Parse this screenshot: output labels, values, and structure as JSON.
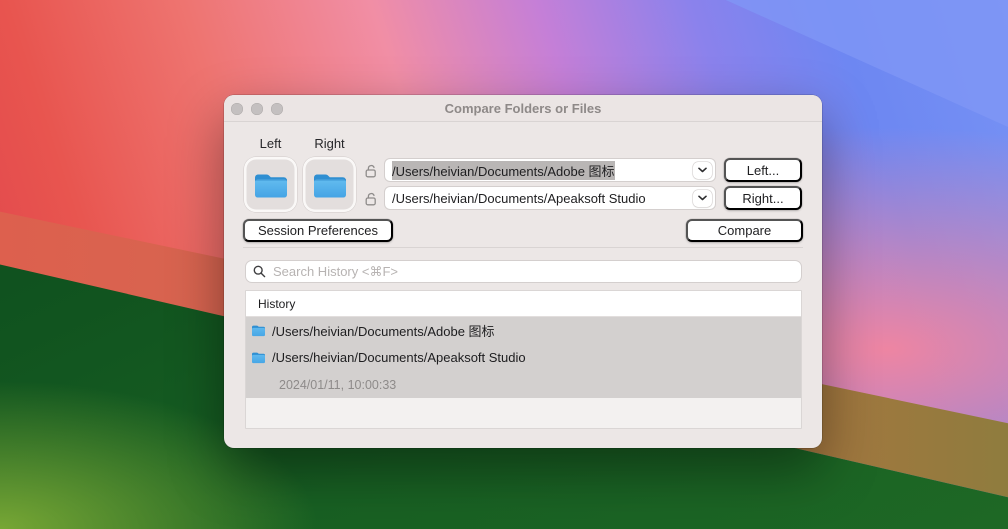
{
  "window": {
    "title": "Compare Folders or Files",
    "pane_labels": {
      "left": "Left",
      "right": "Right"
    },
    "paths": {
      "left": {
        "value": "/Users/heivian/Documents/Adobe 图标",
        "text_selected": true
      },
      "right": {
        "value": "/Users/heivian/Documents/Apeaksoft Studio",
        "text_selected": false
      }
    },
    "buttons": {
      "choose_left": "Left...",
      "choose_right": "Right...",
      "session_preferences": "Session Preferences",
      "compare": "Compare"
    },
    "search": {
      "placeholder": "Search History <⌘F>"
    },
    "history": {
      "column_header": "History",
      "selected_entry": {
        "left_path": "/Users/heivian/Documents/Adobe 图标",
        "right_path": "/Users/heivian/Documents/Apeaksoft Studio",
        "timestamp": "2024/01/11, 10:00:33"
      }
    }
  },
  "icons": [
    "traffic-light",
    "folder-icon",
    "lock-open-icon",
    "chevron-down-icon",
    "search-icon",
    "folder-icon-small"
  ],
  "colors": {
    "window_bg": "#ece7e6",
    "titlebar_text": "#8e8988",
    "folder_blue_light": "#5fb9ee",
    "folder_blue_dark": "#2f8fd2",
    "row_selection_gray": "#d3d0cf",
    "combo_text_selection": "#b9b6b5",
    "wallpaper_red": "#df424b",
    "wallpaper_pink": "#f18ea5",
    "wallpaper_purple": "#8b82ec",
    "wallpaper_blue": "#6d87f2",
    "wallpaper_green_dark": "#0b4a1e",
    "wallpaper_green_light": "#82af37",
    "wallpaper_salmon_band": "#cf6a52"
  }
}
